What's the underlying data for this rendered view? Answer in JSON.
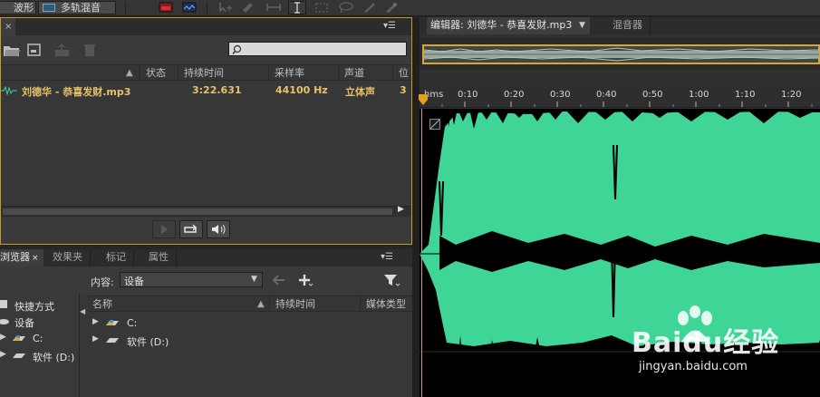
{
  "toolbar": {
    "waveform_label": "波形",
    "multitrack_label": "多轨混音"
  },
  "file_panel": {
    "columns": [
      "状态",
      "持续时间",
      "采样率",
      "声道",
      "位"
    ],
    "file": {
      "name": "刘德华 - 恭喜发财.mp3",
      "duration": "3:22.631",
      "sample_rate": "44100 Hz",
      "channels": "立体声",
      "bits": "3"
    }
  },
  "browser_panel": {
    "tabs": [
      "浏览器",
      "效果夹",
      "标记",
      "属性"
    ],
    "content_label": "内容:",
    "content_value": "设备",
    "tree": [
      "快捷方式",
      "设备",
      "C:",
      "软件 (D:)"
    ],
    "columns": [
      "名称",
      "持续时间",
      "媒体类型"
    ],
    "drives": [
      "C:",
      "软件 (D:)"
    ]
  },
  "editor": {
    "tab_label": "编辑器: 刘德华 - 恭喜发财.mp3",
    "mixer_tab": "混音器",
    "ruler": [
      "hms",
      "0:10",
      "0:20",
      "0:30",
      "0:40",
      "0:50",
      "1:00",
      "1:10",
      "1:20"
    ]
  },
  "watermark": {
    "brand": "Baidu经验",
    "url": "jingyan.baidu.com"
  },
  "colors": {
    "waveform": "#3fd596",
    "panel_focus": "#c49a2c",
    "file_text": "#e8c16a"
  }
}
